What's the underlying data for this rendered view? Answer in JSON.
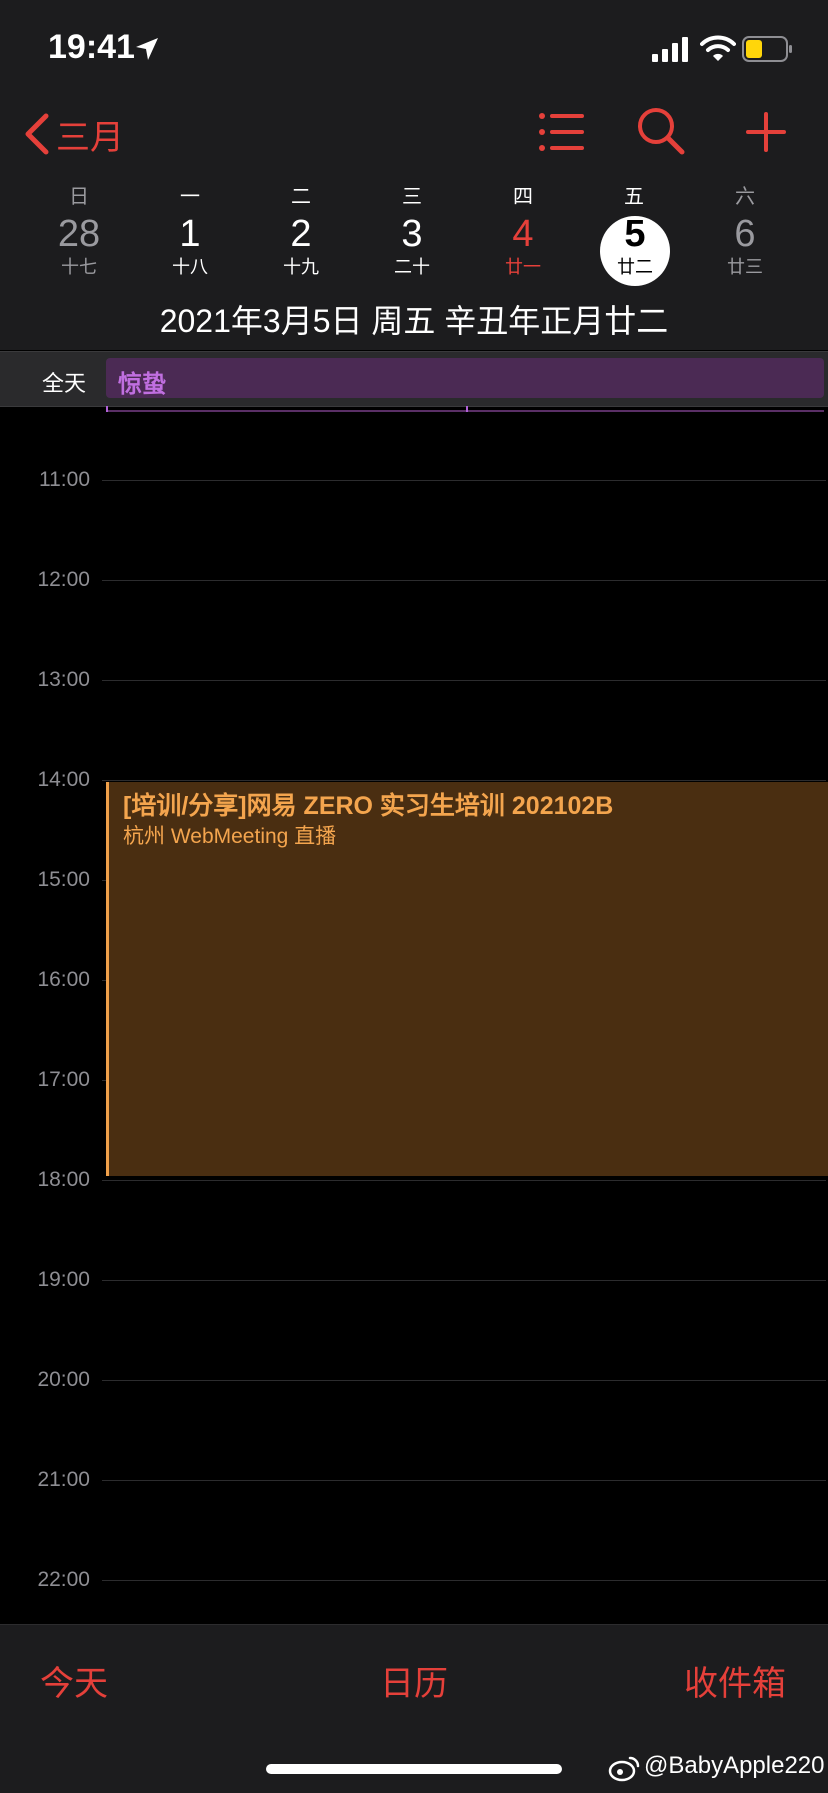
{
  "status": {
    "time": "19:41",
    "colors": {
      "battery": "#ffd60a"
    },
    "icons": [
      "location-arrow-icon",
      "signal-bars-icon",
      "wifi-icon",
      "battery-icon"
    ]
  },
  "nav": {
    "back_label": "三月",
    "icons": [
      "chevron-left-icon",
      "list-icon",
      "search-icon",
      "plus-icon"
    ]
  },
  "week": {
    "weekdays": [
      "日",
      "一",
      "二",
      "三",
      "四",
      "五",
      "六"
    ],
    "days": [
      {
        "num": "28",
        "lunar": "十七"
      },
      {
        "num": "1",
        "lunar": "十八"
      },
      {
        "num": "2",
        "lunar": "十九"
      },
      {
        "num": "3",
        "lunar": "二十"
      },
      {
        "num": "4",
        "lunar": "廿一"
      },
      {
        "num": "5",
        "lunar": "廿二"
      },
      {
        "num": "6",
        "lunar": "廿三"
      }
    ],
    "selected_index": 5
  },
  "date_line": "2021年3月5日 周五   辛丑年正月廿二",
  "all_day": {
    "label": "全天",
    "event": "惊蛰"
  },
  "hours": [
    "11:00",
    "12:00",
    "13:00",
    "14:00",
    "15:00",
    "16:00",
    "17:00",
    "18:00",
    "19:00",
    "20:00",
    "21:00",
    "22:00"
  ],
  "event": {
    "title": "[培训/分享]网易 ZERO 实习生培训 202102B",
    "location": "杭州 WebMeeting 直播",
    "start": "14:00",
    "end": "18:00"
  },
  "tabs": {
    "today": "今天",
    "calendars": "日历",
    "inbox": "收件箱"
  },
  "watermark": "@BabyApple220",
  "colors": {
    "accent": "#e5403a",
    "event": "#f4a54e",
    "all_day": "#c06fe0"
  }
}
